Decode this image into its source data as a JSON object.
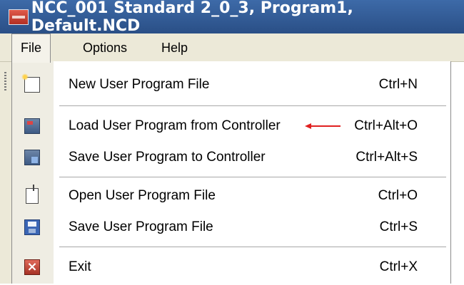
{
  "window": {
    "title": "NCC_001 Standard 2_0_3, Program1, Default.NCD"
  },
  "menubar": {
    "file": "File",
    "options": "Options",
    "help": "Help"
  },
  "file_menu": {
    "items": [
      {
        "label": "New User Program File",
        "shortcut": "Ctrl+N",
        "icon": "new-file-icon"
      },
      {
        "label": "Load User Program from Controller",
        "shortcut": "Ctrl+Alt+O",
        "icon": "load-from-controller-icon"
      },
      {
        "label": "Save User Program to Controller",
        "shortcut": "Ctrl+Alt+S",
        "icon": "save-to-controller-icon"
      },
      {
        "label": "Open User Program File",
        "shortcut": "Ctrl+O",
        "icon": "open-file-icon"
      },
      {
        "label": "Save User Program File",
        "shortcut": "Ctrl+S",
        "icon": "save-disk-icon"
      },
      {
        "label": "Exit",
        "shortcut": "Ctrl+X",
        "icon": "exit-icon"
      }
    ]
  },
  "colors": {
    "titlebar": "#2f5a96",
    "menubar": "#ece9d8",
    "arrow": "#e02020"
  }
}
